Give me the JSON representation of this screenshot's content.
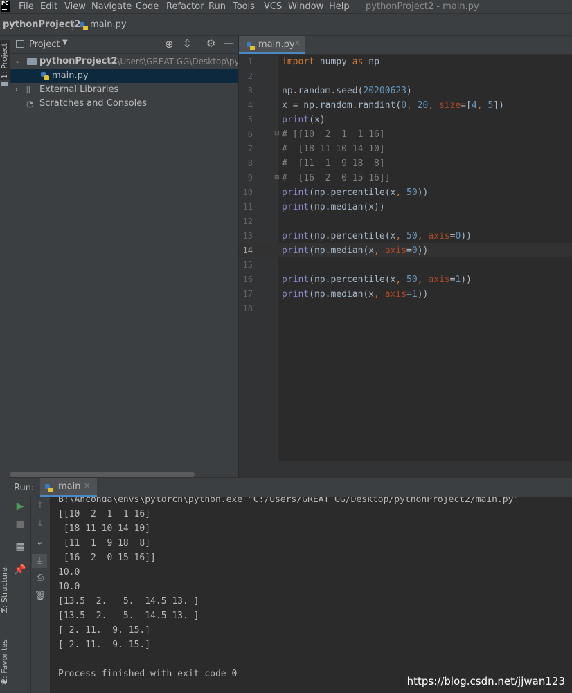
{
  "menubar": {
    "logo": "PC",
    "items": [
      "File",
      "Edit",
      "View",
      "Navigate",
      "Code",
      "Refactor",
      "Run",
      "Tools",
      "VCS",
      "Window",
      "Help"
    ],
    "window_title": "pythonProject2 - main.py"
  },
  "navbar": {
    "project": "pythonProject2",
    "file": "main.py"
  },
  "sidebar": {
    "project_tab": "1: Project",
    "structure_tab": "Z: Structure",
    "favorites_tab": "2: Favorites"
  },
  "project_panel": {
    "title": "Project",
    "tree": {
      "root_name": "pythonProject2",
      "root_path": "C:\\Users\\GREAT GG\\Desktop\\py",
      "file": "main.py",
      "external": "External Libraries",
      "scratches": "Scratches and Consoles"
    }
  },
  "editor": {
    "tab_label": "main.py",
    "current_line": 14,
    "line_numbers": [
      "1",
      "2",
      "3",
      "4",
      "5",
      "6",
      "7",
      "8",
      "9",
      "10",
      "11",
      "12",
      "13",
      "14",
      "15",
      "16",
      "17",
      "18"
    ],
    "code": [
      "import numpy as np",
      "",
      "np.random.seed(20200623)",
      "x = np.random.randint(0, 20, size=[4, 5])",
      "print(x)",
      "# [[10  2  1  1 16]",
      "#  [18 11 10 14 10]",
      "#  [11  1  9 18  8]",
      "#  [16  2  0 15 16]]",
      "print(np.percentile(x, 50))",
      "print(np.median(x))",
      "",
      "print(np.percentile(x, 50, axis=0))",
      "print(np.median(x, axis=0))",
      "",
      "print(np.percentile(x, 50, axis=1))",
      "print(np.median(x, axis=1))",
      ""
    ]
  },
  "run_panel": {
    "label": "Run:",
    "tab": "main",
    "output": [
      "B:\\Anconda\\envs\\pytorch\\python.exe \"C:/Users/GREAT GG/Desktop/pythonProject2/main.py\"",
      "[[10  2  1  1 16]",
      " [18 11 10 14 10]",
      " [11  1  9 18  8]",
      " [16  2  0 15 16]]",
      "10.0",
      "10.0",
      "[13.5  2.   5.  14.5 13. ]",
      "[13.5  2.   5.  14.5 13. ]",
      "[ 2. 11.  9. 15.]",
      "[ 2. 11.  9. 15.]",
      "",
      "Process finished with exit code 0"
    ]
  },
  "watermark": "https://blog.csdn.net/jjwan123",
  "colors": {
    "keyword": "#cc7832",
    "number": "#6897bb",
    "comment": "#808080",
    "builtin": "#8888c6",
    "param": "#aa4926",
    "run_green": "#499c54"
  }
}
